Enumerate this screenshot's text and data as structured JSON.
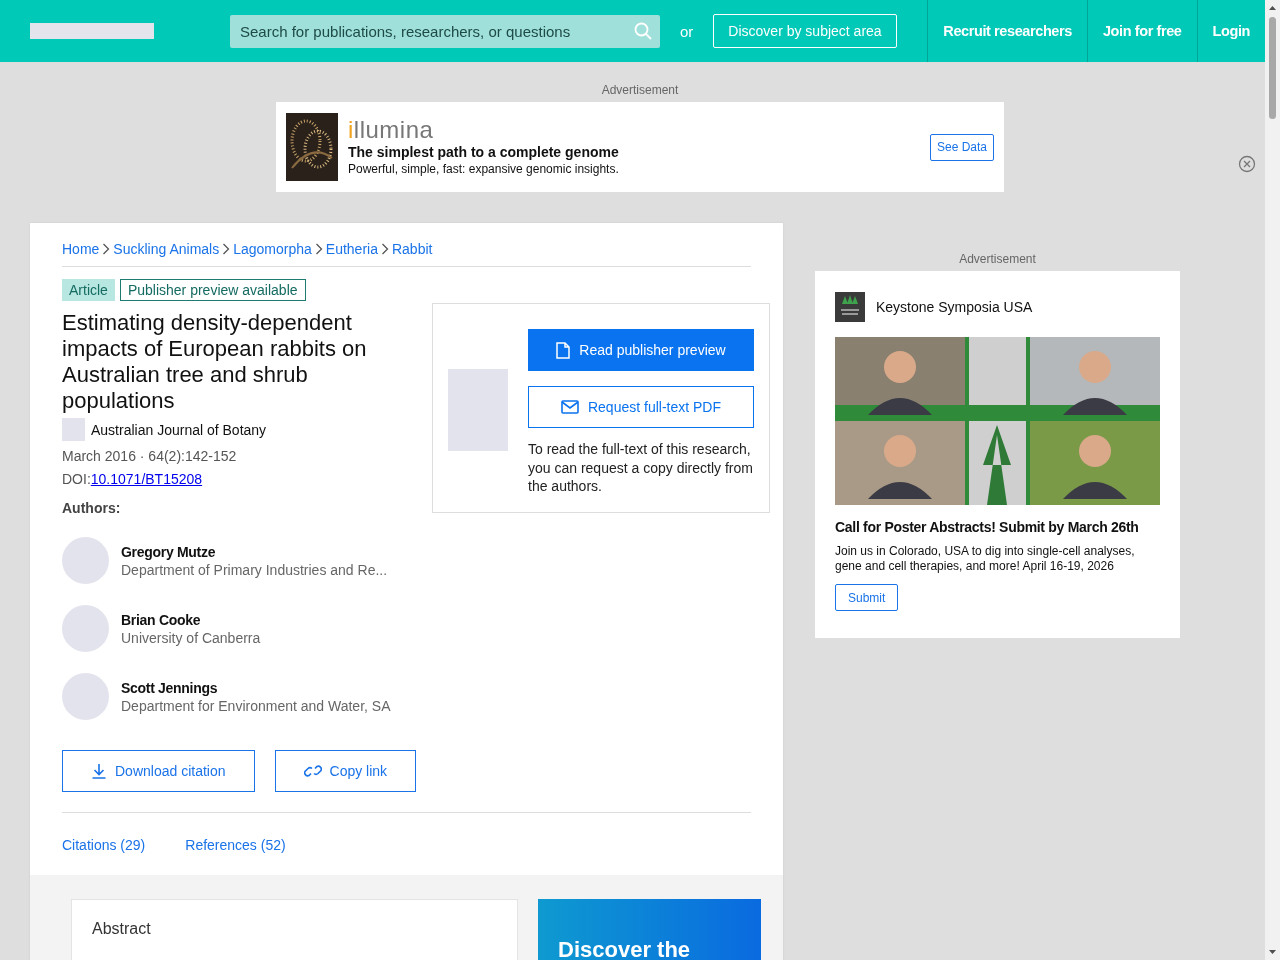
{
  "topbar": {
    "search": {
      "placeholder": "Search for publications, researchers, or questions"
    },
    "or_label": "or",
    "discover_button": "Discover by subject area",
    "nav": [
      "Recruit researchers",
      "Join for free",
      "Login"
    ]
  },
  "top_ad": {
    "label": "Advertisement",
    "brand": "illumina",
    "headline": "The simplest path to a complete genome",
    "text": "Powerful, simple, fast: expansive genomic insights.",
    "button": "See Data"
  },
  "breadcrumb": [
    "Home",
    "Suckling Animals",
    "Lagomorpha",
    "Eutheria",
    "Rabbit"
  ],
  "tags": [
    {
      "label": "Article",
      "kind": "filled"
    },
    {
      "label": "Publisher preview available",
      "kind": "outline"
    }
  ],
  "title": "Estimating density-dependent impacts of European rabbits on Australian tree and shrub populations",
  "journal": "Australian Journal of Botany",
  "date": "March 2016 · 64(2):142-152",
  "doi_label": "DOI:",
  "doi": "10.1071/BT15208",
  "authors_label": "Authors:",
  "authors": [
    {
      "name": "Gregory Mutze",
      "affiliation": "Department of Primary Industries and Re..."
    },
    {
      "name": "Brian Cooke",
      "affiliation": "University of Canberra"
    },
    {
      "name": "Scott Jennings",
      "affiliation": "Department for Environment and Water, SA"
    }
  ],
  "actions": [
    {
      "label": "Download citation",
      "kind": "download"
    },
    {
      "label": "Copy link",
      "kind": "link"
    }
  ],
  "section_links": [
    "Citations (29)",
    "References (52)"
  ],
  "access_panel": {
    "primary_button": "Read publisher preview",
    "secondary_button": "Request full-text PDF",
    "note": "To read the full-text of this research, you can request a copy directly from the authors."
  },
  "abstract_heading": "Abstract",
  "promo_heading": "Discover the",
  "side_ad": {
    "label": "Advertisement",
    "sponsor": "Keystone Symposia USA",
    "headline": "Call for Poster Abstracts! Submit by March 26th",
    "text": "Join us in Colorado, USA to dig into single-cell analyses, gene and cell therapies, and more! April 16-19, 2026",
    "button": "Submit"
  }
}
